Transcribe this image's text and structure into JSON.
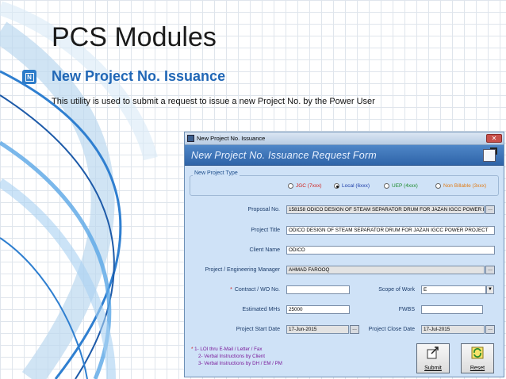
{
  "slide": {
    "title": "PCS Modules",
    "subtitle": "New Project No. Issuance",
    "description": "This utility is used to submit a request to issue a new Project No. by the Power User"
  },
  "window": {
    "title": "New Project No. Issuance",
    "close_label": "✕",
    "form_header": "New Project No. Issuance Request Form"
  },
  "project_type": {
    "legend": "New Project Type",
    "options": [
      {
        "label": "JGC (7xxx)",
        "color": "#d0211d",
        "selected": false
      },
      {
        "label": "Local (6xxx)",
        "color": "#1d3ea8",
        "selected": true
      },
      {
        "label": "UEP (4xxx)",
        "color": "#1b8a2c",
        "selected": false
      },
      {
        "label": "Non Billable (3xxx)",
        "color": "#e07b16",
        "selected": false
      }
    ]
  },
  "fields": {
    "proposal_no": {
      "label": "Proposal No.",
      "value": "158158 ODICO DESIGN OF STEAM SEPARATOR DRUM FOR JAZAN IGCC POWER PROJ"
    },
    "project_title": {
      "label": "Project Title",
      "value": "ODICO DESIGN OF STEAM SEPARATOR DRUM FOR JAZAN IGCC POWER PROJECT"
    },
    "client_name": {
      "label": "Client Name",
      "value": "ODICO"
    },
    "manager": {
      "label": "Project / Engineering Manager",
      "value": "AHMAD FAROOQ"
    },
    "contract": {
      "label": "Contract / WO No.",
      "required_mark": "*",
      "value": ""
    },
    "scope": {
      "label": "Scope of Work",
      "value": "E"
    },
    "mhs": {
      "label": "Estimated MHs",
      "value": "25000"
    },
    "fwbs": {
      "label": "FWBS",
      "value": ""
    },
    "start_date": {
      "label": "Project Start Date",
      "value": "17-Jun-2015"
    },
    "close_date": {
      "label": "Project Close Date",
      "value": "17-Jul-2015"
    }
  },
  "notes": {
    "star": "*",
    "line1": "1- LOI thru E-Mail / Letter / Fax",
    "line2": "2- Verbal Instructions by Client",
    "line3": "3- Verbal Instructions by DH / EM / PM"
  },
  "buttons": {
    "submit": "Submit",
    "reset": "Reset",
    "dots": "...",
    "combo_arrow": "▼"
  },
  "colors": {
    "accent": "#2167b6",
    "form_header": "#2f64a8",
    "window_bg": "#cfe2f7",
    "required": "#d0211d"
  }
}
